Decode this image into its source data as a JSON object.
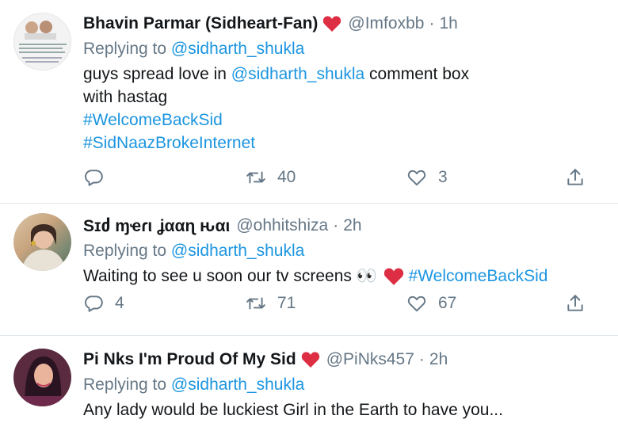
{
  "colors": {
    "link": "#1b95e0",
    "muted": "#657786",
    "heart": "#e0245e",
    "divider": "#e1e8ed"
  },
  "tweets": [
    {
      "name": "Bhavin Parmar (Sidheart-Fan)",
      "handle": "@Imfoxbb",
      "time": "1h",
      "replying_prefix": "Replying to ",
      "replying_to": "@sidharth_shukla",
      "text_part1": "guys spread love in ",
      "mention": "@sidharth_shukla",
      "text_part2": " comment box",
      "text_line2": "with hastag",
      "hashtag1": "#WelcomeBackSid",
      "hashtag2": "#SidNaazBrokeInternet",
      "replies": "",
      "retweets": "40",
      "likes": "3"
    },
    {
      "name": "Sɪძ ɱҽɾι ʝααɳ ԋαι",
      "handle": "@ohhitshiza",
      "time": "2h",
      "replying_prefix": "Replying to ",
      "replying_to": "@sidharth_shukla",
      "text": "Waiting to see u soon our tv screens 👀",
      "hashtag": "#WelcomeBackSid",
      "replies": "4",
      "retweets": "71",
      "likes": "67"
    },
    {
      "name": "Pi Nks I'm Proud Of My Sid",
      "handle": "@PiNks457",
      "time": "2h",
      "replying_prefix": "Replying to ",
      "replying_to": "@sidharth_shukla",
      "text": "Any lady would be luckiest Girl in the Earth to have you..."
    }
  ]
}
